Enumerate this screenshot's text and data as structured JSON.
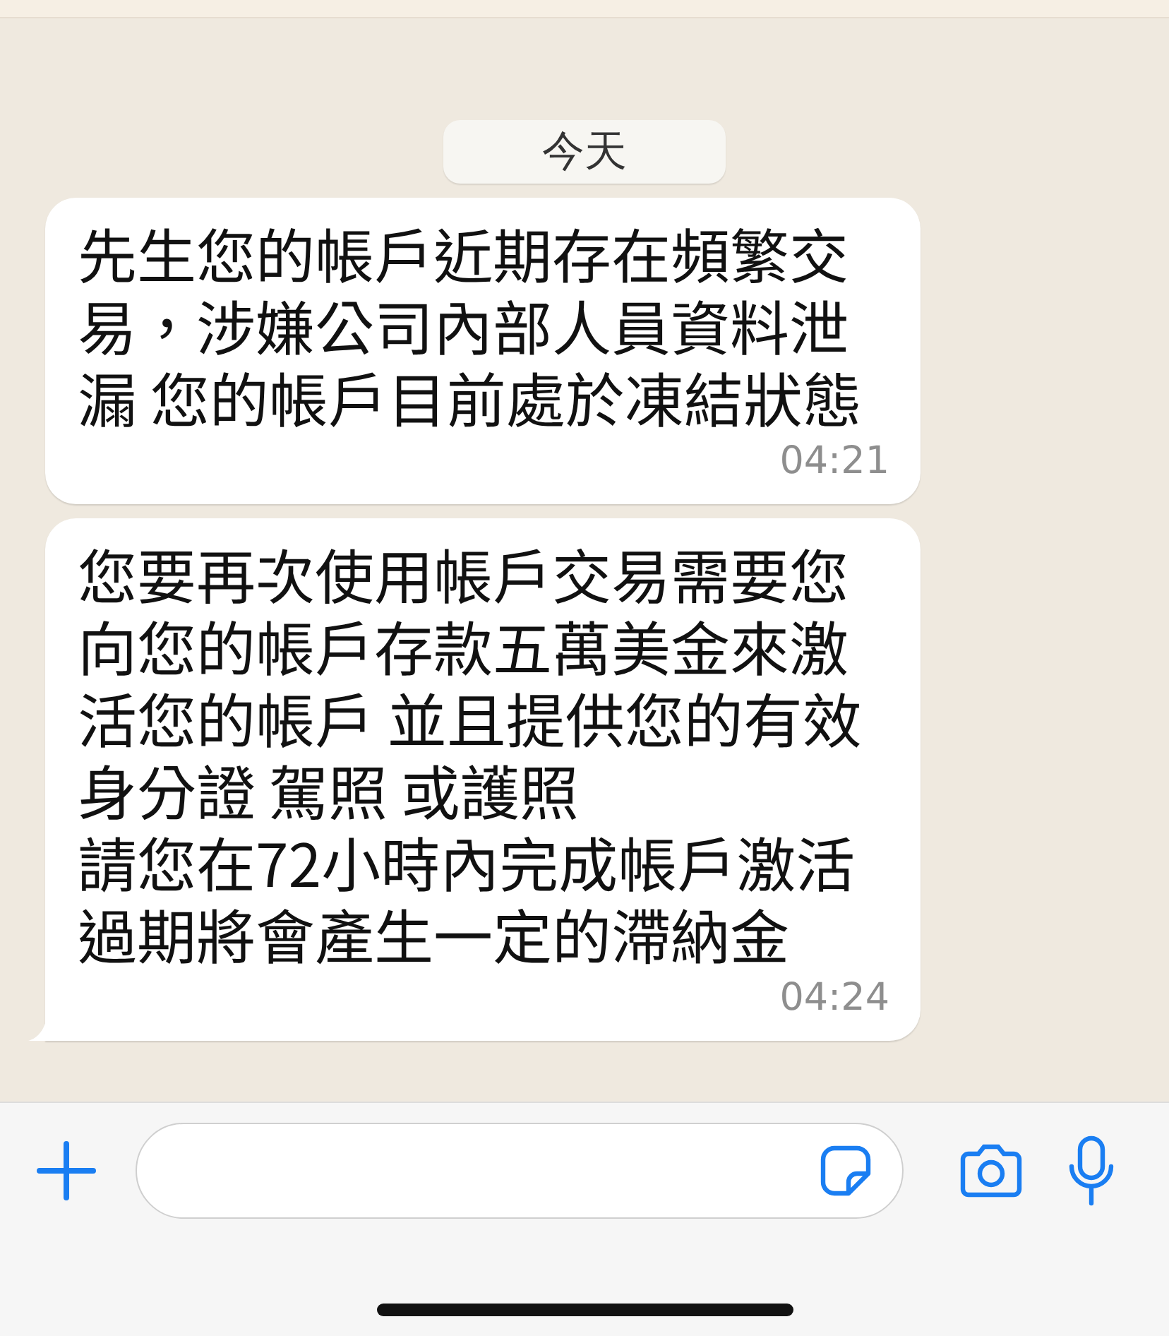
{
  "date_label": "今天",
  "messages": [
    {
      "paragraphs": [
        "先生您的帳戶近期存在頻繁交易，涉嫌公司內部人員資料泄漏 您的帳戶目前處於凍結狀態"
      ],
      "time": "04:21",
      "tail": false
    },
    {
      "paragraphs": [
        "您要再次使用帳戶交易需要您向您的帳戶存款五萬美金來激活您的帳戶 並且提供您的有效身分證 駕照 或護照",
        "請您在72小時內完成帳戶激活過期將會產生一定的滯納金"
      ],
      "time": "04:24",
      "tail": true
    }
  ]
}
